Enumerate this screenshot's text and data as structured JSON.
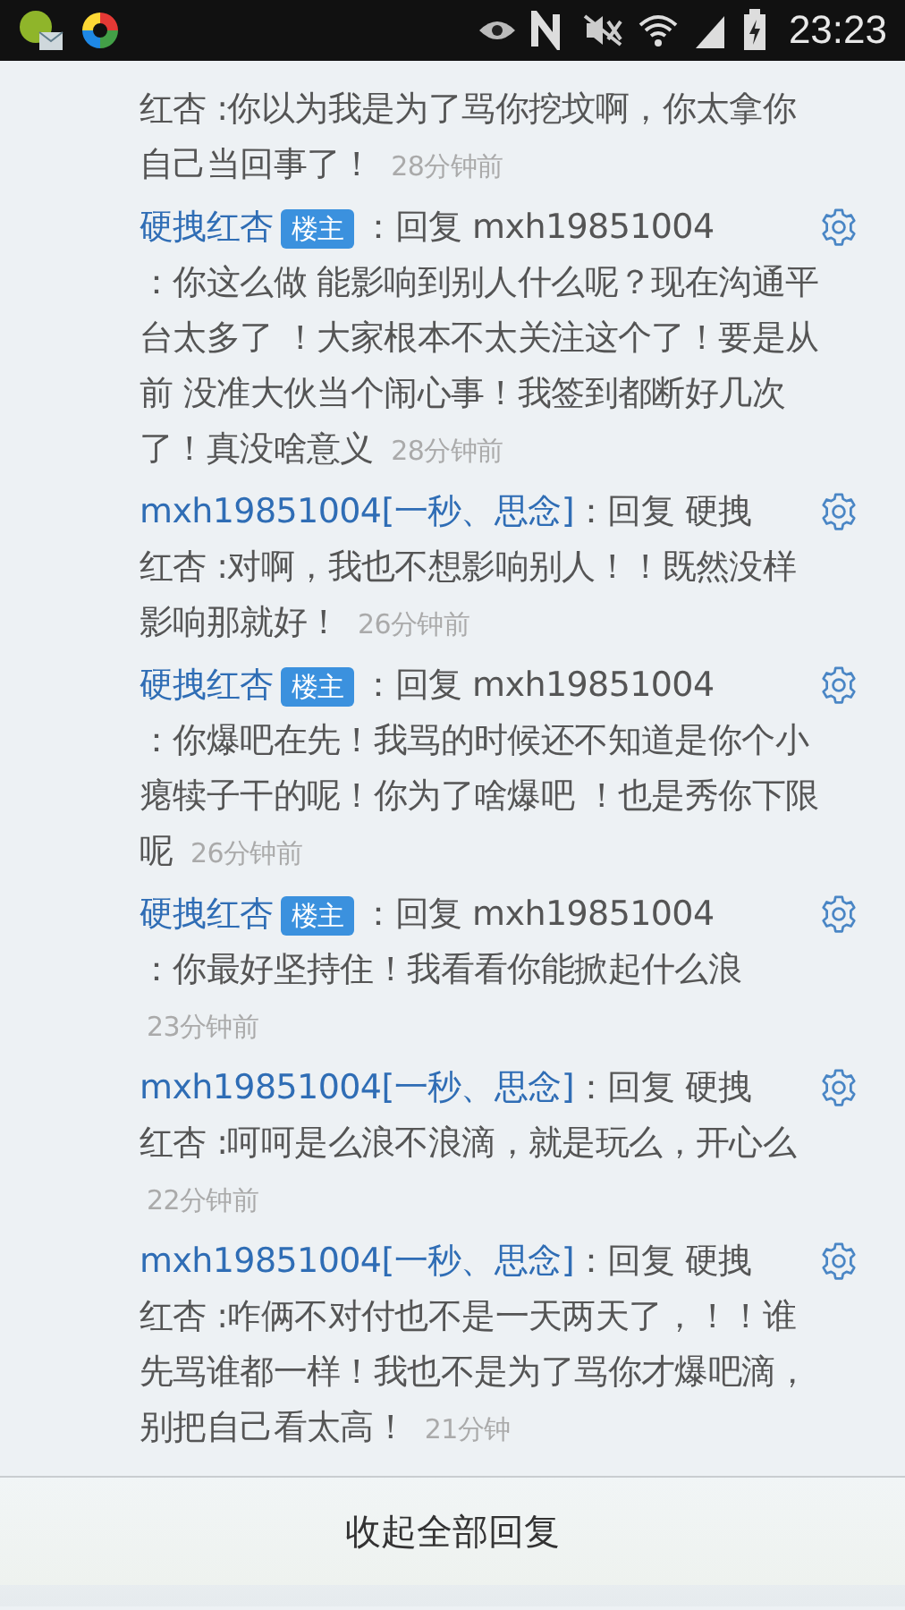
{
  "status_bar": {
    "time": "23:23"
  },
  "replies": [
    {
      "text": "红杏 :你以为我是为了骂你挖坟啊，你太拿你自己当回事了！",
      "time": "28分钟前"
    },
    {
      "author": "硬拽红杏",
      "badge": "楼主",
      "reply_to": "：回复 mxh19851004",
      "text": "：你这么做 能影响到别人什么呢？现在沟通平台太多了 ！大家根本不太关注这个了！要是从前 没准大伙当个闹心事！我签到都断好几次了！真没啥意义",
      "time": "28分钟前"
    },
    {
      "author": "mxh19851004[一秒、思念]",
      "reply_to": "：回复 硬拽",
      "text": "红杏 :对啊，我也不想影响别人！！既然没样影响那就好！",
      "time": "26分钟前"
    },
    {
      "author": "硬拽红杏",
      "badge": "楼主",
      "reply_to": "：回复 mxh19851004",
      "text": "：你爆吧在先！我骂的时候还不知道是你个小瘪犊子干的呢！你为了啥爆吧 ！也是秀你下限呢",
      "time": "26分钟前"
    },
    {
      "author": "硬拽红杏",
      "badge": "楼主",
      "reply_to": "：回复 mxh19851004",
      "text": "：你最好坚持住！我看看你能掀起什么浪",
      "time": "23分钟前"
    },
    {
      "author": "mxh19851004[一秒、思念]",
      "reply_to": "：回复 硬拽",
      "text": "红杏 :呵呵是么浪不浪滴，就是玩么，开心么",
      "time": "22分钟前"
    },
    {
      "author": "mxh19851004[一秒、思念]",
      "reply_to": "：回复 硬拽",
      "text": "红杏 :咋俩不对付也不是一天两天了，！！谁先骂谁都一样！我也不是为了骂你才爆吧滴，别把自己看太高！",
      "time": "21分钟"
    }
  ],
  "collapse_button": "收起全部回复"
}
